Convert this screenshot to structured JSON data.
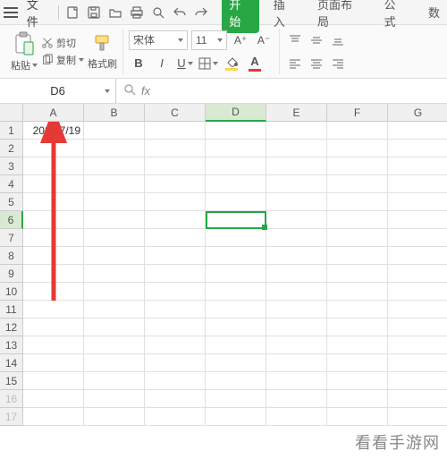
{
  "menu": {
    "file": "文件",
    "tabs": [
      "开始",
      "插入",
      "页面布局",
      "公式",
      "数"
    ],
    "active_tab_index": 0
  },
  "ribbon": {
    "paste_label": "粘贴",
    "cut_label": "剪切",
    "copy_label": "复制",
    "format_painter_label": "格式刷",
    "font_name": "宋体",
    "font_size": "11",
    "size_inc_label": "A⁺",
    "size_dec_label": "A⁻"
  },
  "formula_bar": {
    "cell_ref": "D6",
    "fx": "fx",
    "value": ""
  },
  "grid": {
    "columns": [
      "A",
      "B",
      "C",
      "D",
      "E",
      "F",
      "G"
    ],
    "rows": [
      "1",
      "2",
      "3",
      "4",
      "5",
      "6",
      "7",
      "8",
      "9",
      "10",
      "11",
      "12",
      "13",
      "14",
      "15",
      "16",
      "17"
    ],
    "active_cell": "D6",
    "active_col_index": 3,
    "active_row_index": 5,
    "cells": {
      "A1": "2024/7/19"
    }
  },
  "watermark": "看看手游网",
  "chart_data": {
    "type": "table",
    "title": "",
    "columns": [
      "A",
      "B",
      "C",
      "D",
      "E",
      "F",
      "G"
    ],
    "data": [
      [
        "2024/7/19",
        "",
        "",
        "",
        "",
        "",
        ""
      ],
      [
        "",
        "",
        "",
        "",
        "",
        "",
        ""
      ],
      [
        "",
        "",
        "",
        "",
        "",
        "",
        ""
      ],
      [
        "",
        "",
        "",
        "",
        "",
        "",
        ""
      ],
      [
        "",
        "",
        "",
        "",
        "",
        "",
        ""
      ],
      [
        "",
        "",
        "",
        "",
        "",
        "",
        ""
      ],
      [
        "",
        "",
        "",
        "",
        "",
        "",
        ""
      ],
      [
        "",
        "",
        "",
        "",
        "",
        "",
        ""
      ],
      [
        "",
        "",
        "",
        "",
        "",
        "",
        ""
      ],
      [
        "",
        "",
        "",
        "",
        "",
        "",
        ""
      ],
      [
        "",
        "",
        "",
        "",
        "",
        "",
        ""
      ],
      [
        "",
        "",
        "",
        "",
        "",
        "",
        ""
      ],
      [
        "",
        "",
        "",
        "",
        "",
        "",
        ""
      ],
      [
        "",
        "",
        "",
        "",
        "",
        "",
        ""
      ],
      [
        "",
        "",
        "",
        "",
        "",
        "",
        ""
      ],
      [
        "",
        "",
        "",
        "",
        "",
        "",
        ""
      ],
      [
        "",
        "",
        "",
        "",
        "",
        "",
        ""
      ]
    ]
  }
}
